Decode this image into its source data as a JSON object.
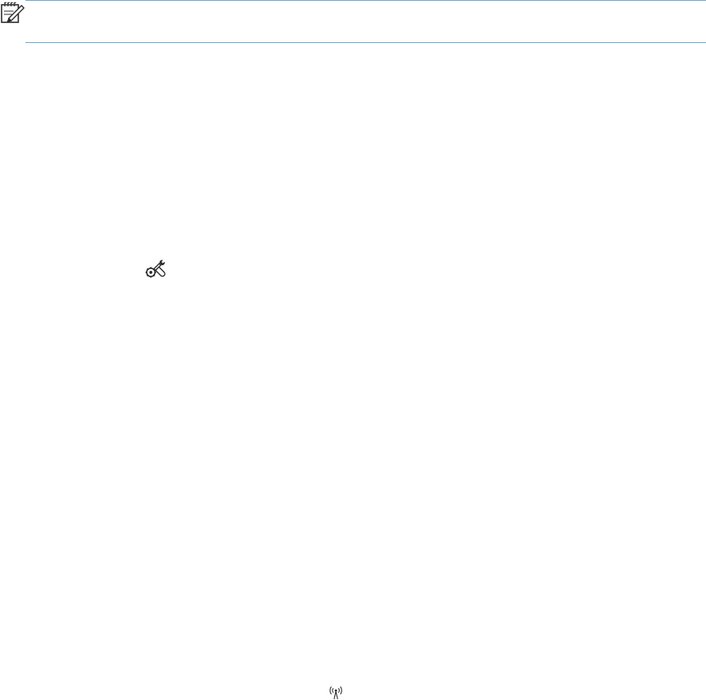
{
  "note": {
    "icon": "note-pencil-icon",
    "rule_color": "#67a7d6"
  },
  "icons": {
    "setup": "setup-wrench-gear-icon",
    "wireless": "wireless-antenna-icon"
  }
}
